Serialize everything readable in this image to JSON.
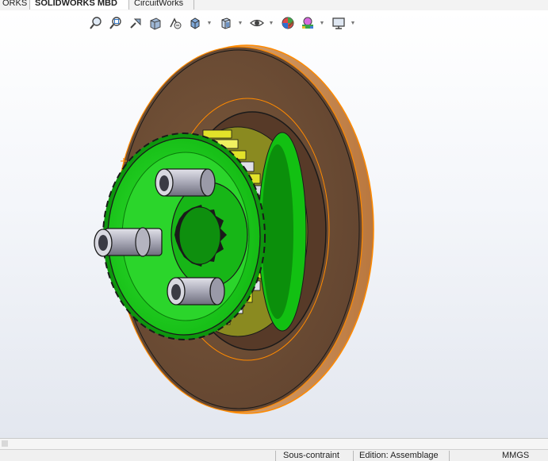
{
  "tabs": [
    "ORKS",
    "SOLIDWORKS MBD",
    "CircuitWorks"
  ],
  "hud_icons": [
    "zoom-to-fit-icon",
    "zoom-area-icon",
    "previous-view-icon",
    "section-view-icon",
    "dynamic-annotation-icon",
    "view-orientation-icon",
    "display-style-icon",
    "hide-show-items-icon",
    "edit-appearance-icon",
    "apply-scene-icon",
    "view-settings-icon"
  ],
  "status": {
    "state": "Sous-contraint",
    "mode": "Edition: Assemblage",
    "units": "MMGS"
  },
  "colors": {
    "disc": "#6e4e35",
    "disc_edge": "#e8ad73",
    "gear": "#19d419",
    "gear_dark": "#0b8f0b",
    "teeth": "#e2e22a",
    "shaft": "#b4b4c0",
    "selection": "#ff8a00"
  }
}
